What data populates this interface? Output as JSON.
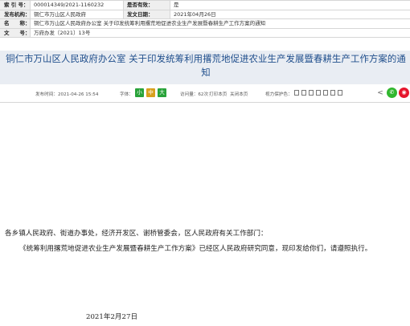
{
  "meta": {
    "index_label": "索 引 号：",
    "index_value": "000014349/2021-1160232",
    "valid_label": "是否有效：",
    "valid_value": "是",
    "org_label": "发布机构：",
    "org_value": "铜仁市万山区人民政府",
    "date_label": "发文日期：",
    "date_value": "2021年04月26日",
    "name_label": "名　　称：",
    "name_value": "铜仁市万山区人民政府办公室 关于印发统筹利用撂荒地促进农业生产发展暨春耕生产工作方案的通知",
    "doc_label": "文　　号：",
    "doc_value": "万府办发〔2021〕13号"
  },
  "title": "铜仁市万山区人民政府办公室 关于印发统筹利用撂荒地促进农业生产发展暨春耕生产工作方案的通知",
  "info": {
    "publish": "发布时间：2021-04-26 15:54",
    "font_label": "字体：",
    "font_small": "小",
    "font_mid": "中",
    "font_big": "大",
    "views": "访问量：62次",
    "print": "打印本页",
    "close": "关闭本页",
    "mode": "视力保护色："
  },
  "content": {
    "greeting": "各乡镇人民政府、街道办事处，经济开发区、谢桥管委会，区人民政府有关工作部门：",
    "paragraph": "《统筹利用撂荒地促进农业生产发展暨春耕生产工作方案》已经区人民政府研究同意，现印发给你们，请遵照执行。",
    "date": "2021年2月27日"
  },
  "colors": {
    "title": "#1f4e8c",
    "title_band": "#e9edf3",
    "font_green": "#29a33a",
    "font_orange": "#d8a11d"
  }
}
